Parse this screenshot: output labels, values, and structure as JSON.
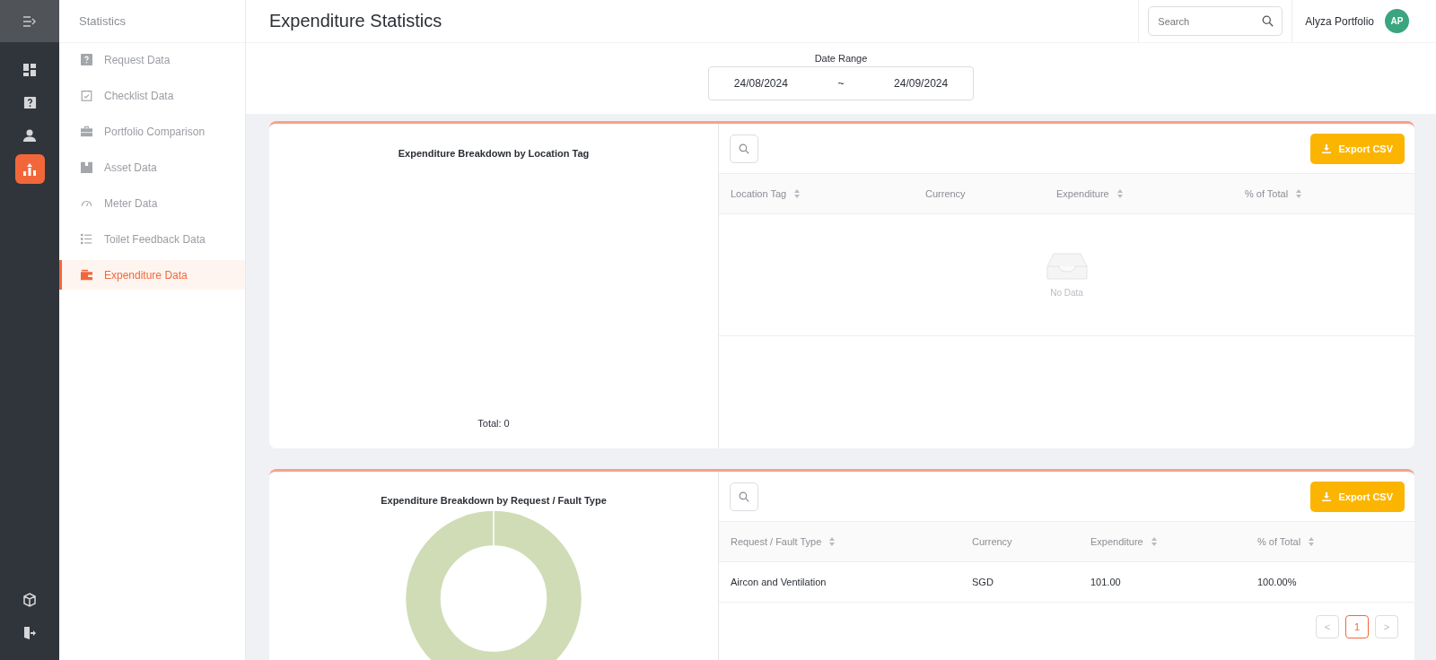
{
  "rail": {
    "items": [
      {
        "kind": "dashboard",
        "selected": false
      },
      {
        "kind": "request",
        "selected": false
      },
      {
        "kind": "user",
        "selected": false
      },
      {
        "kind": "statistics",
        "selected": true
      }
    ],
    "bottom_items": [
      {
        "kind": "cube"
      },
      {
        "kind": "logout"
      }
    ]
  },
  "sidebar": {
    "title": "Statistics",
    "items": [
      {
        "label": "Request Data",
        "kind": "request",
        "selected": false
      },
      {
        "label": "Checklist Data",
        "kind": "checklist",
        "selected": false
      },
      {
        "label": "Portfolio Comparison",
        "kind": "briefcase",
        "selected": false
      },
      {
        "label": "Asset Data",
        "kind": "box",
        "selected": false
      },
      {
        "label": "Meter Data",
        "kind": "gauge",
        "selected": false
      },
      {
        "label": "Toilet Feedback Data",
        "kind": "list",
        "selected": false
      },
      {
        "label": "Expenditure Data",
        "kind": "wallet",
        "selected": true
      }
    ]
  },
  "header": {
    "title": "Expenditure Statistics",
    "search": {
      "placeholder": "Search"
    },
    "user": {
      "name": "Alyza Portfolio",
      "initials": "AP"
    }
  },
  "date_range": {
    "label": "Date Range",
    "start": "24/08/2024",
    "separator": "~",
    "end": "24/09/2024"
  },
  "panels": [
    {
      "chart_title": "Expenditure Breakdown by Location Tag",
      "kind": "empty",
      "total": "Total: 0",
      "export_label": "Export CSV",
      "columns": [
        {
          "label": "Location Tag",
          "sortable": true
        },
        {
          "label": "Currency",
          "sortable": false
        },
        {
          "label": "Expenditure",
          "sortable": true
        },
        {
          "label": "% of Total",
          "sortable": true
        }
      ],
      "empty_text": "No Data"
    },
    {
      "chart_title": "Expenditure Breakdown by Request / Fault Type",
      "kind": "donut",
      "export_label": "Export CSV",
      "columns": [
        {
          "label": "Request / Fault Type",
          "sortable": true
        },
        {
          "label": "Currency",
          "sortable": false
        },
        {
          "label": "Expenditure",
          "sortable": true
        },
        {
          "label": "% of Total",
          "sortable": true
        }
      ],
      "rows": [
        [
          "Aircon and Ventilation",
          "SGD",
          "101.00",
          "100.00%"
        ]
      ],
      "pagination": {
        "prev": "<",
        "pages": [
          {
            "label": "1",
            "selected": true
          }
        ],
        "next": ">"
      }
    }
  ]
}
